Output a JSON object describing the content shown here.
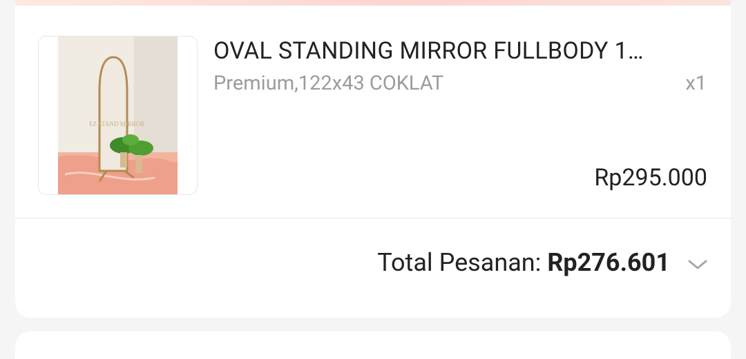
{
  "order_item": {
    "product_name": "OVAL STANDING MIRROR FULLBODY 1…",
    "variant": "Premium,122x43 COKLAT",
    "quantity": "x1",
    "price": "Rp295.000",
    "image_watermark": "EZ STAND MIRROR"
  },
  "order_total": {
    "label": "Total Pesanan: ",
    "amount": "Rp276.601",
    "expand_icon": "chevron-down-icon"
  },
  "colors": {
    "accent_band": "#fcd5cf",
    "text_primary": "#222222",
    "text_secondary": "#9b9b9b",
    "card_background": "#ffffff",
    "page_background": "#f5f5f5"
  }
}
